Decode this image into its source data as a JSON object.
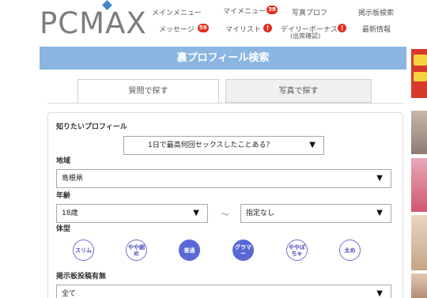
{
  "logo": {
    "text": "PCMAX"
  },
  "nav": {
    "main_menu": "メインメニュー",
    "my_menu": "マイメニュー",
    "my_menu_badge": "38",
    "photo_prof": "写真プロフ",
    "bbs_search": "掲示板検索",
    "message": "メッセージ",
    "message_badge": "59",
    "my_list": "マイリスト",
    "my_list_alert": "!",
    "daily_bonus": "デイリーボーナス",
    "daily_bonus_sub": "(出席確認)",
    "daily_bonus_alert": "!",
    "latest": "最新情報"
  },
  "page_title": "裏プロフィール検索",
  "tabs": {
    "question": "質問で探す",
    "photo": "写真で探す"
  },
  "form": {
    "profile_label": "知りたいプロフィール",
    "profile_value": "1日で最高何回セックスしたことある？",
    "region_label": "地域",
    "region_value": "島根県",
    "age_label": "年齢",
    "age_min": "18歳",
    "age_tilde": "〜",
    "age_max": "指定なし",
    "body_label": "体型",
    "body_types": [
      "スリム",
      "やや細め",
      "普通",
      "グラマー",
      "ややぽちゃ",
      "太め"
    ],
    "bbs_label": "掲示板投稿有無",
    "bbs_value": "全て",
    "arrow": "▼"
  },
  "colors": {
    "title_bar": "#8ab6e1",
    "badge": "#e0301e",
    "body_type_selected": "#5a68d6",
    "body_type_outline": "#6b6fd0"
  }
}
